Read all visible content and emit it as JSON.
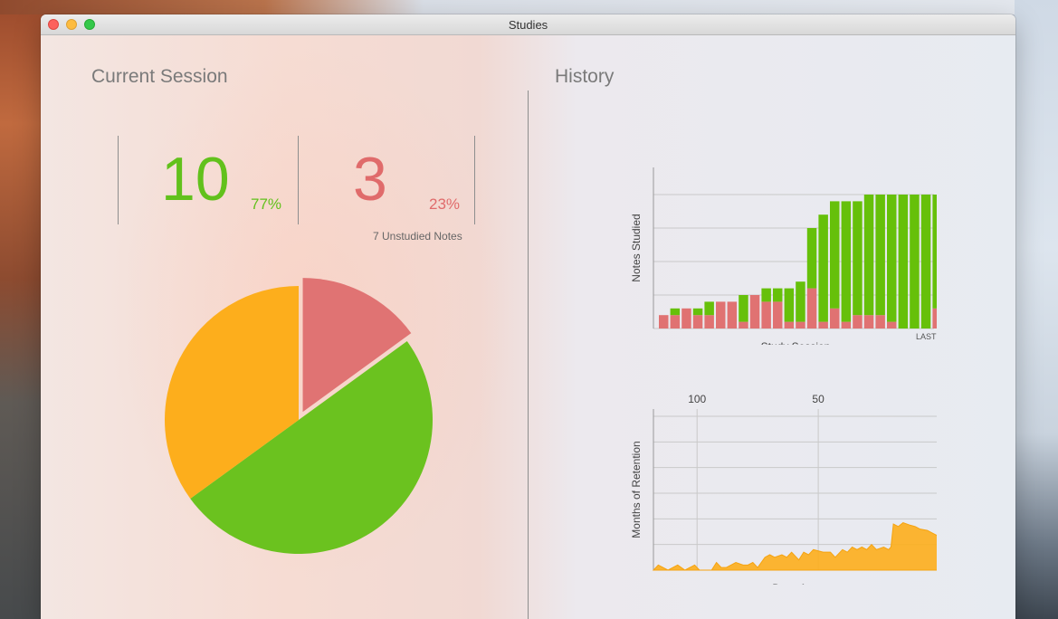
{
  "window": {
    "title": "Studies"
  },
  "current_session": {
    "title": "Current Session",
    "studied_count": "10",
    "studied_pct": "77%",
    "unstudied_count": "3",
    "unstudied_pct": "23%",
    "unstudied_notes": "7 Unstudied Notes",
    "pie": [
      {
        "name": "unstudied",
        "value": 3,
        "color": "#e07373",
        "exploded": true
      },
      {
        "name": "studied",
        "value": 10,
        "color": "#6bc21f"
      },
      {
        "name": "remaining",
        "value": 7,
        "color": "#fdae1c"
      }
    ]
  },
  "history": {
    "title": "History"
  },
  "chart_data": [
    {
      "type": "bar",
      "xlabel": "Study Session",
      "ylabel": "Notes Studied",
      "x_end_label": "LAST",
      "ylim": [
        0,
        20
      ],
      "yticks": [
        0,
        5,
        10,
        15,
        20
      ],
      "grid": true,
      "colors": {
        "studied": "#66c00a",
        "missed": "#e07272"
      },
      "series": [
        {
          "name": "missed",
          "values": [
            2,
            2,
            3,
            2,
            2,
            4,
            4,
            1,
            5,
            4,
            4,
            1,
            1,
            6,
            1,
            3,
            1,
            2,
            2,
            2,
            1,
            0,
            0,
            0,
            3
          ]
        },
        {
          "name": "studied",
          "values": [
            0,
            1,
            0,
            1,
            2,
            0,
            0,
            4,
            0,
            2,
            2,
            5,
            6,
            9,
            16,
            16,
            18,
            17,
            18,
            18,
            19,
            20,
            20,
            20,
            17
          ]
        }
      ]
    },
    {
      "type": "area",
      "xlabel": "Days Ago",
      "ylabel": "Months of Retention",
      "xlim": [
        118,
        0
      ],
      "xticks": [
        100,
        50,
        0
      ],
      "ylim": [
        0,
        6
      ],
      "yticks": [
        0,
        1,
        2,
        3,
        4,
        5,
        6
      ],
      "grid": true,
      "color": "#fdae1c",
      "x": [
        118,
        116,
        112,
        108,
        105,
        101,
        99,
        96,
        94,
        92,
        90,
        88,
        84,
        81,
        79,
        77,
        75,
        72,
        70,
        68,
        65,
        63,
        61,
        58,
        56,
        54,
        52,
        48,
        45,
        43,
        40,
        38,
        36,
        34,
        32,
        30,
        28,
        26,
        23,
        21,
        20,
        19,
        17,
        15,
        12,
        10,
        8,
        5,
        3,
        1,
        0
      ],
      "y": [
        0,
        0.2,
        0,
        0.2,
        0,
        0.2,
        0,
        0,
        0,
        0.3,
        0.1,
        0.1,
        0.3,
        0.2,
        0.2,
        0.3,
        0.1,
        0.5,
        0.6,
        0.5,
        0.6,
        0.5,
        0.7,
        0.4,
        0.7,
        0.6,
        0.8,
        0.7,
        0.7,
        0.5,
        0.8,
        0.7,
        0.9,
        0.8,
        0.9,
        0.8,
        1.0,
        0.8,
        0.9,
        0.8,
        0.9,
        1.8,
        1.7,
        1.85,
        1.75,
        1.7,
        1.6,
        1.55,
        1.45,
        1.35,
        1.9
      ]
    }
  ]
}
